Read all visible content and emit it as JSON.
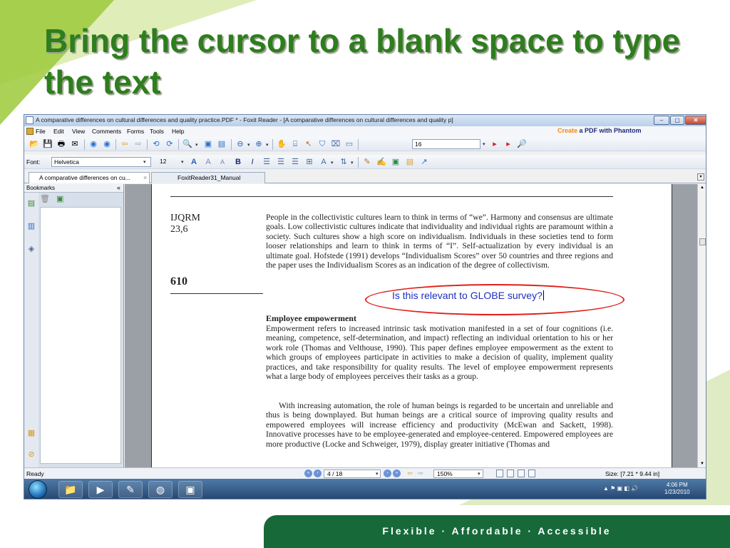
{
  "slide": {
    "title": "Bring the cursor to a blank space to type the text",
    "footer": "Flexible  ·  Affordable  ·  Accessible"
  },
  "window": {
    "title": "A comparative differences on cultural differences and quality practice.PDF * - Foxit Reader - [A comparative differences on cultural differences and quality p]",
    "controls": {
      "minimize": "–",
      "maximize": "▢",
      "close": "✕"
    }
  },
  "menu": {
    "items": [
      "File",
      "Edit",
      "View",
      "Comments",
      "Forms",
      "Tools",
      "Help"
    ],
    "promo_prefix": "Create",
    "promo_rest": " a PDF with Phantom"
  },
  "toolbar": {
    "zoom_value": "16"
  },
  "format_bar": {
    "font_label": "Font:",
    "font_value": "Helvetica",
    "size_value": "12"
  },
  "tabs": [
    {
      "label": "A comparative differences on cu...",
      "close": "×"
    },
    {
      "label": "FoxitReader31_Manual"
    }
  ],
  "sidebar": {
    "title": "Bookmarks",
    "collapse": "«"
  },
  "document": {
    "journal": "IJQRM",
    "volume": "23,6",
    "page_number": "610",
    "para1": "People in the collectivistic cultures learn to think in terms of “we”. Harmony and consensus are ultimate goals. Low collectivistic cultures indicate that individuality and individual rights are paramount within a society. Such cultures show a high score on individualism. Individuals in these societies tend to form looser relationships and learn to think in terms of “I”. Self-actualization by every individual is an ultimate goal. Hofstede (1991) develops “Individualism Scores” over 50 countries and three regions and the paper uses the Individualism Scores as an indication of the degree of collectivism.",
    "heading": "Employee empowerment",
    "para2": "Empowerment refers to increased intrinsic task motivation manifested in a set of four cognitions (i.e. meaning, competence, self-determination, and impact) reflecting an individual orientation to his or her work role (Thomas and Velthouse, 1990). This paper defines employee empowerment as the extent to which groups of employees participate in activities to make a decision of quality, implement quality practices, and take responsibility for quality results. The level of employee empowerment represents what a large body of employees perceives their tasks as a group.",
    "para3": "With increasing automation, the role of human beings is regarded to be uncertain and unreliable and thus is being downplayed. But human beings are a critical source of improving quality results and empowered employees will increase efficiency and productivity (McEwan and Sackett, 1998). Innovative processes have to be employee-generated and employee-centered. Empowered employees are more productive (Locke and Schweiger, 1979), display greater initiative (Thomas and",
    "annotation": "Is this relevant to GLOBE survey?"
  },
  "statusbar": {
    "status": "Ready",
    "page_indicator": "4 / 18",
    "zoom": "150%",
    "page_size": "Size: [7.21 * 9.44 in]"
  },
  "taskbar": {
    "time": "4:06 PM",
    "date": "1/23/2010"
  },
  "colors": {
    "title_green": "#2e7d1e",
    "footer_green": "#17693a",
    "annotation_blue": "#1f2fbf",
    "ellipse_red": "#e0201b",
    "accent_orange": "#f08a16"
  }
}
